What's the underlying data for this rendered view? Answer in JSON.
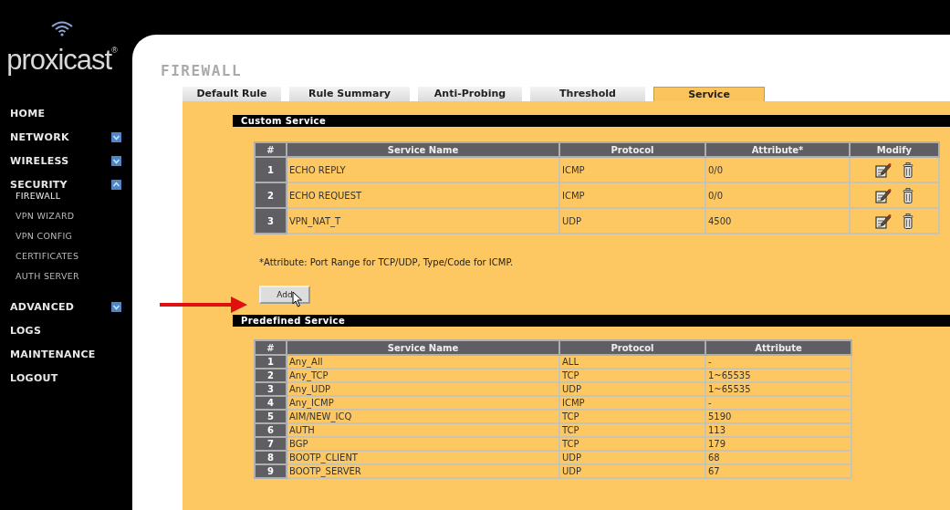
{
  "logo": {
    "text": "proxicast$^{®}$"
  },
  "nav": [
    {
      "label": "HOME",
      "expandable": false
    },
    {
      "label": "NETWORK",
      "expandable": true,
      "expanded": false
    },
    {
      "label": "WIRELESS",
      "expandable": true,
      "expanded": false
    },
    {
      "label": "SECURITY",
      "expandable": true,
      "expanded": true,
      "children": [
        {
          "label": "FIREWALL",
          "selected": true
        },
        {
          "label": "VPN WIZARD",
          "selected": false
        },
        {
          "label": "VPN CONFIG",
          "selected": false
        },
        {
          "label": "CERTIFICATES",
          "selected": false
        },
        {
          "label": "AUTH SERVER",
          "selected": false
        }
      ]
    },
    {
      "label": "ADVANCED",
      "expandable": true,
      "expanded": false
    },
    {
      "label": "LOGS",
      "expandable": false
    },
    {
      "label": "MAINTENANCE",
      "expandable": false
    },
    {
      "label": "LOGOUT",
      "expandable": false
    }
  ],
  "page": {
    "title": "FIREWALL"
  },
  "tabs": [
    {
      "label": "Default Rule",
      "selected": false
    },
    {
      "label": "Rule Summary",
      "selected": false
    },
    {
      "label": "Anti-Probing",
      "selected": false
    },
    {
      "label": "Threshold",
      "selected": false
    },
    {
      "label": "Service",
      "selected": true
    }
  ],
  "custom_service": {
    "title": "Custom Service",
    "columns": [
      "#",
      "Service Name",
      "Protocol",
      "Attribute*",
      "Modify"
    ],
    "rows": [
      {
        "index": "1",
        "name": "ECHO REPLY",
        "protocol": "ICMP",
        "attribute": "0/0"
      },
      {
        "index": "2",
        "name": "ECHO REQUEST",
        "protocol": "ICMP",
        "attribute": "0/0"
      },
      {
        "index": "3",
        "name": "VPN_NAT_T",
        "protocol": "UDP",
        "attribute": "4500"
      }
    ],
    "footnote": "*Attribute: Port Range for TCP/UDP, Type/Code for ICMP.",
    "add_button": "Add"
  },
  "predefined_service": {
    "title": "Predefined Service",
    "columns": [
      "#",
      "Service Name",
      "Protocol",
      "Attribute"
    ],
    "rows": [
      {
        "index": "1",
        "name": "Any_All",
        "protocol": "ALL",
        "attribute": "-"
      },
      {
        "index": "2",
        "name": "Any_TCP",
        "protocol": "TCP",
        "attribute": "1~65535"
      },
      {
        "index": "3",
        "name": "Any_UDP",
        "protocol": "UDP",
        "attribute": "1~65535"
      },
      {
        "index": "4",
        "name": "Any_ICMP",
        "protocol": "ICMP",
        "attribute": "-"
      },
      {
        "index": "5",
        "name": "AIM/NEW_ICQ",
        "protocol": "TCP",
        "attribute": "5190"
      },
      {
        "index": "6",
        "name": "AUTH",
        "protocol": "TCP",
        "attribute": "113"
      },
      {
        "index": "7",
        "name": "BGP",
        "protocol": "TCP",
        "attribute": "179"
      },
      {
        "index": "8",
        "name": "BOOTP_CLIENT",
        "protocol": "UDP",
        "attribute": "68"
      },
      {
        "index": "9",
        "name": "BOOTP_SERVER",
        "protocol": "UDP",
        "attribute": "67"
      }
    ]
  }
}
